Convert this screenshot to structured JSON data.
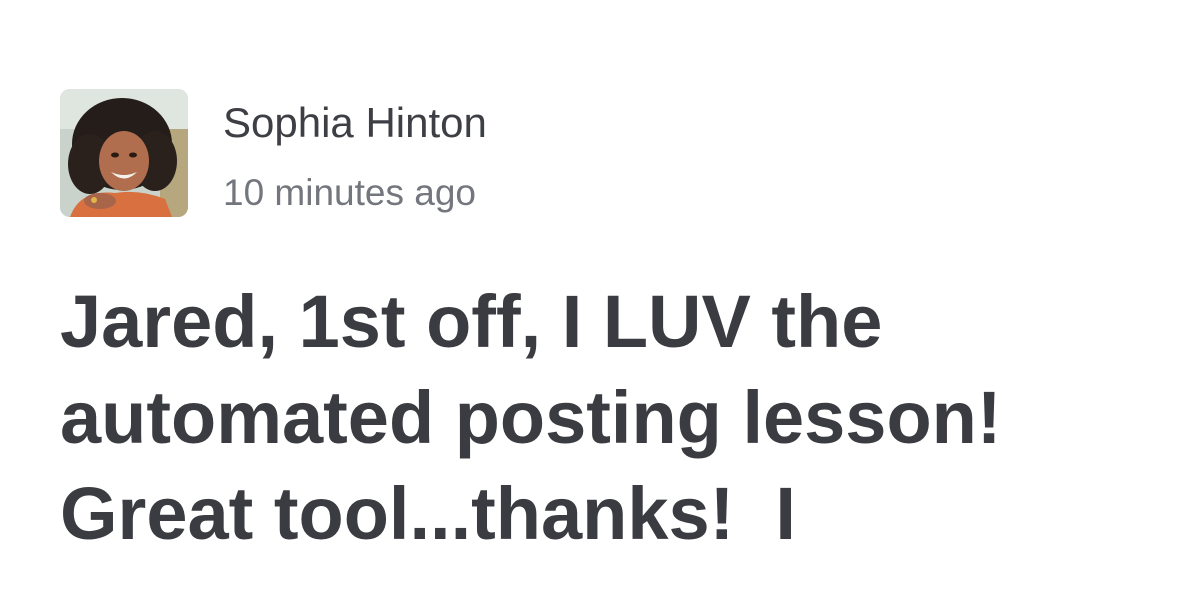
{
  "post": {
    "author": "Sophia Hinton",
    "timestamp": "10 minutes ago",
    "avatar_icon": "profile-photo",
    "body": "Jared, 1st off, I LUV the\nautomated posting lesson!\nGreat tool...thanks!  I"
  },
  "colors": {
    "author": "#3d3f44",
    "timestamp": "#73767c",
    "body": "#3a3c41",
    "background": "#ffffff"
  }
}
